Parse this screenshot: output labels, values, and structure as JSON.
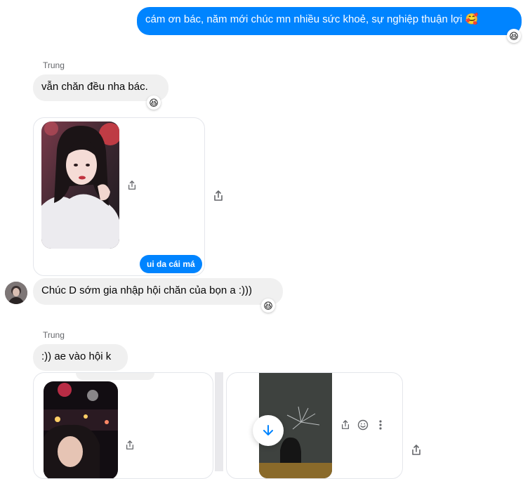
{
  "messages": {
    "m1": {
      "text": "cám ơn bác, năm mới chúc mn nhiều sức khoẻ, sự nghiệp thuận lợi 🥰",
      "reaction": "😆"
    },
    "m2": {
      "sender": "Trung",
      "text": "vẫn chăn đều nha bác.",
      "reaction": "😆"
    },
    "m3": {
      "reply_chip": "ui da cái má"
    },
    "m4": {
      "text": "Chúc D sớm gia nhập hội chăn của bọn a :)))",
      "reaction": "😆"
    },
    "m5": {
      "sender": "Trung",
      "text": ":)) ae vào hội k"
    }
  },
  "icons": {
    "share": "share-icon",
    "emoji": "smiley-icon",
    "more": "more-vertical-icon",
    "scroll_down": "arrow-down-icon"
  },
  "colors": {
    "accent": "#0084ff",
    "incoming": "#f0f0f0",
    "meta": "#65676b"
  }
}
